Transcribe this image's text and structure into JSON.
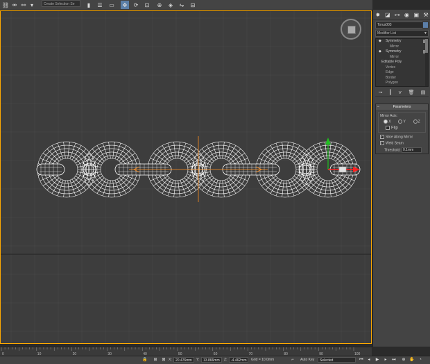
{
  "toolbar": {
    "selection_filter": "Create Selection Se",
    "icons": [
      "link-icon",
      "unlink-icon",
      "bind-spacewarp-icon",
      "select-filter-icon",
      "select-object-icon",
      "select-by-name-icon",
      "rect-region-icon",
      "window-crossing-icon",
      "move-icon",
      "rotate-icon",
      "scale-icon",
      "reference-coord-icon",
      "pivot-icon",
      "mirror-icon",
      "align-icon",
      "layers-icon",
      "curve-editor-icon",
      "schematic-icon",
      "material-editor-icon",
      "render-setup-icon",
      "render-icon"
    ]
  },
  "command_panel": {
    "object_name": "Torus003",
    "modifier_list": "Modifier List",
    "stack": [
      {
        "label": "Symmetry",
        "level": "top",
        "on": true
      },
      {
        "label": "Mirror",
        "level": "sub"
      },
      {
        "label": "Symmetry",
        "level": "top",
        "on": true
      },
      {
        "label": "Mirror",
        "level": "sub"
      },
      {
        "label": "Editable Poly",
        "level": "base"
      },
      {
        "label": "Vertex",
        "level": "sub"
      },
      {
        "label": "Edge",
        "level": "sub"
      },
      {
        "label": "Border",
        "level": "sub"
      },
      {
        "label": "Polygon",
        "level": "sub"
      }
    ],
    "parameters": {
      "title": "Parameters",
      "mirror_axis_label": "Mirror Axis:",
      "axes": [
        "X",
        "Y",
        "Z"
      ],
      "selected_axis": "X",
      "flip_label": "Flip",
      "flip_checked": false,
      "slice_label": "Slice Along Mirror",
      "slice_checked": true,
      "weld_label": "Weld Seam",
      "weld_checked": true,
      "threshold_label": "Threshold:",
      "threshold_value": "0.1mm"
    }
  },
  "ruler": {
    "ticks": [
      "0",
      "10",
      "20",
      "30",
      "40",
      "50",
      "60",
      "70",
      "80",
      "90",
      "100"
    ],
    "start_label": "0",
    "end_label": "100"
  },
  "status": {
    "x_label": "X:",
    "x_value": "20.476mm",
    "y_label": "Y:",
    "y_value": "13.866mm",
    "z_label": "Z:",
    "z_value": "-4.462mm",
    "grid": "Grid = 10.0mm",
    "auto_key": "Auto Key",
    "selected": "Selected",
    "set_key": "Set Key",
    "key_filters": "Key Filters..."
  },
  "colors": {
    "active_border": "#ffaa00",
    "wire": "#ffffff",
    "axis_x": "#ff2020",
    "axis_y": "#20c020",
    "gizmo": "#ff9020"
  }
}
